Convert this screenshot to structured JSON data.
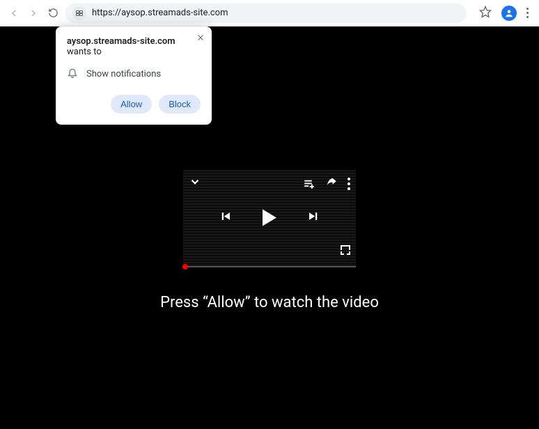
{
  "browser": {
    "url": "https://aysop.streamads-site.com"
  },
  "perm_popup": {
    "site": "aysop.streamads-site.com",
    "suffix": " wants to",
    "row_label": "Show notifications",
    "allow_label": "Allow",
    "block_label": "Block"
  },
  "page": {
    "cta": "Press “Allow” to watch the video"
  }
}
